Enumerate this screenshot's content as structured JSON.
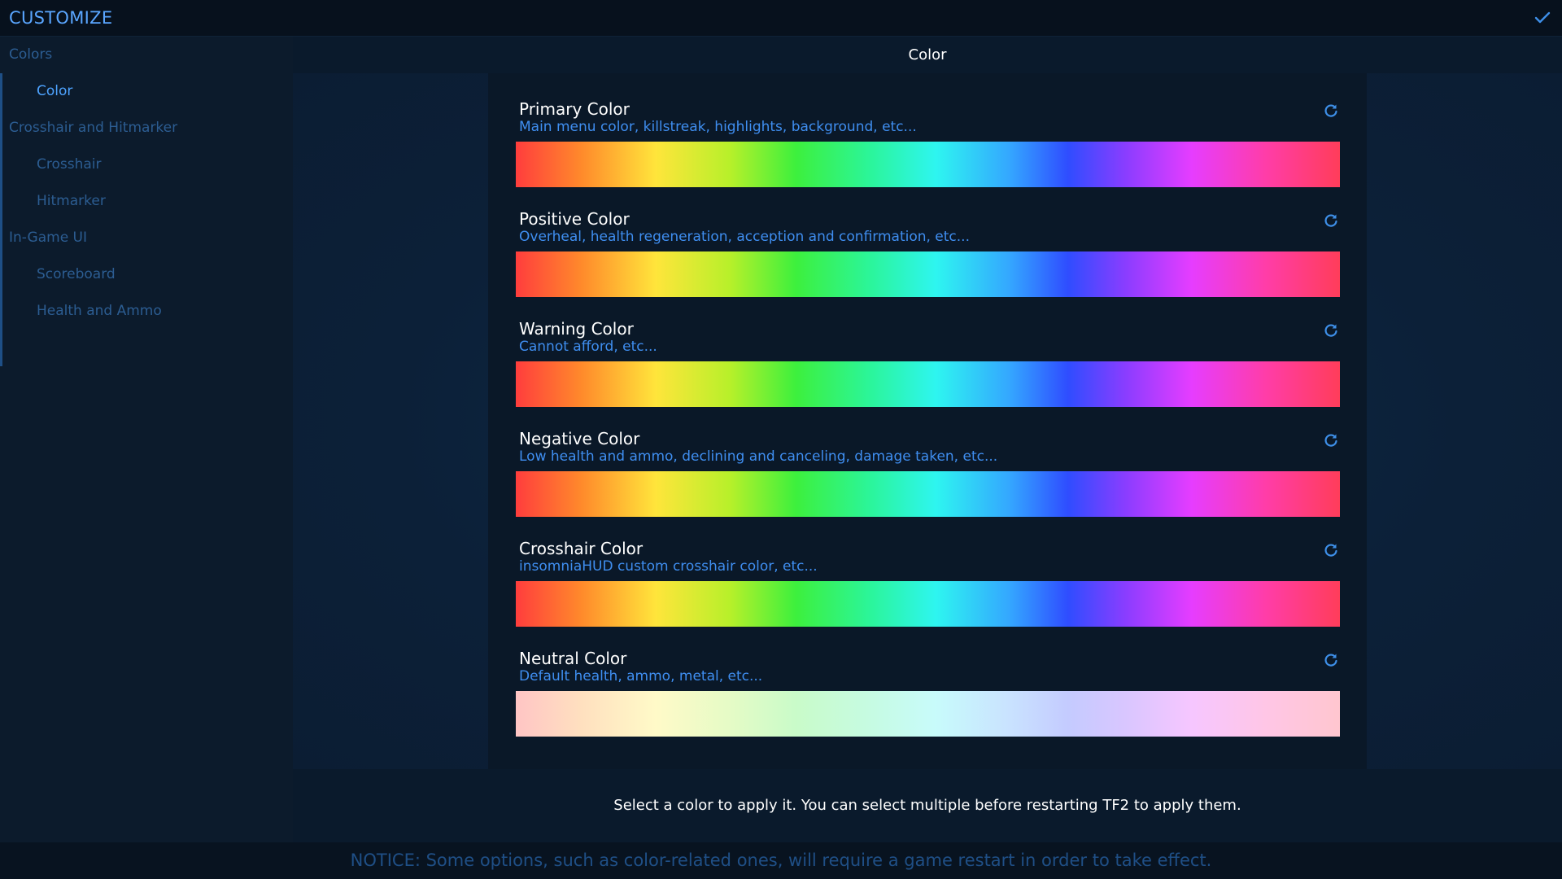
{
  "app": {
    "title": "CUSTOMIZE"
  },
  "sidebar": {
    "groups": [
      {
        "label": "Colors",
        "items": [
          {
            "label": "Color",
            "active": true
          }
        ]
      },
      {
        "label": "Crosshair and Hitmarker",
        "items": [
          {
            "label": "Crosshair"
          },
          {
            "label": "Hitmarker"
          }
        ]
      },
      {
        "label": "In-Game UI",
        "items": [
          {
            "label": "Scoreboard"
          },
          {
            "label": "Health and Ammo"
          }
        ]
      }
    ]
  },
  "content": {
    "header": "Color",
    "rows": [
      {
        "title": "Primary Color",
        "description": "Main menu color, killstreak, highlights, background, etc...",
        "palette": "rainbow"
      },
      {
        "title": "Positive Color",
        "description": "Overheal, health regeneration, acception and confirmation, etc...",
        "palette": "rainbow"
      },
      {
        "title": "Warning Color",
        "description": "Cannot afford, etc...",
        "palette": "rainbow"
      },
      {
        "title": "Negative Color",
        "description": "Low health and ammo, declining and canceling, damage taken, etc...",
        "palette": "rainbow"
      },
      {
        "title": "Crosshair Color",
        "description": "insomniaHUD custom crosshair color, etc...",
        "palette": "rainbow"
      },
      {
        "title": "Neutral Color",
        "description": "Default health, ammo, metal, etc...",
        "palette": "pastel"
      }
    ],
    "hint": "Select a color to apply it. You can select multiple before restarting TF2 to apply them."
  },
  "notice": "NOTICE: Some options, such as color-related ones, will require a game restart in order to take effect.",
  "icons": {
    "confirm": "checkmark-icon",
    "reset": "reset-icon"
  },
  "colors": {
    "accent": "#4ea3ff",
    "section": "#2c5d92",
    "description": "#3f8ef0"
  }
}
